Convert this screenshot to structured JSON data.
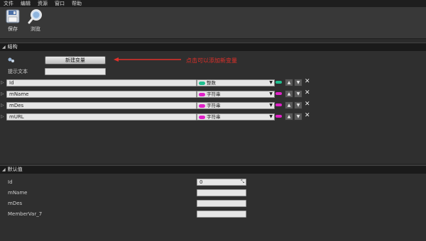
{
  "menu": [
    "文件",
    "编辑",
    "资源",
    "窗口",
    "帮助"
  ],
  "toolbar": {
    "save_label": "保存",
    "browse_label": "浏览"
  },
  "structure": {
    "title": "结构",
    "new_var_button": "新建变量",
    "tooltip_label": "提示文本",
    "tooltip_value": "",
    "annotation": "点击可以添加新变量",
    "variables": [
      {
        "name": "Id",
        "type": "整数",
        "color": "#1fbf8f"
      },
      {
        "name": "mName",
        "type": "字符串",
        "color": "#e020c8"
      },
      {
        "name": "mDes",
        "type": "字符串",
        "color": "#e020c8"
      },
      {
        "name": "mURL",
        "type": "字符串",
        "color": "#e020c8"
      }
    ]
  },
  "defaults": {
    "title": "默认值",
    "fields": [
      {
        "label": "Id",
        "value": "0"
      },
      {
        "label": "mName",
        "value": ""
      },
      {
        "label": "mDes",
        "value": ""
      },
      {
        "label": "MemberVar_7",
        "value": ""
      }
    ]
  }
}
